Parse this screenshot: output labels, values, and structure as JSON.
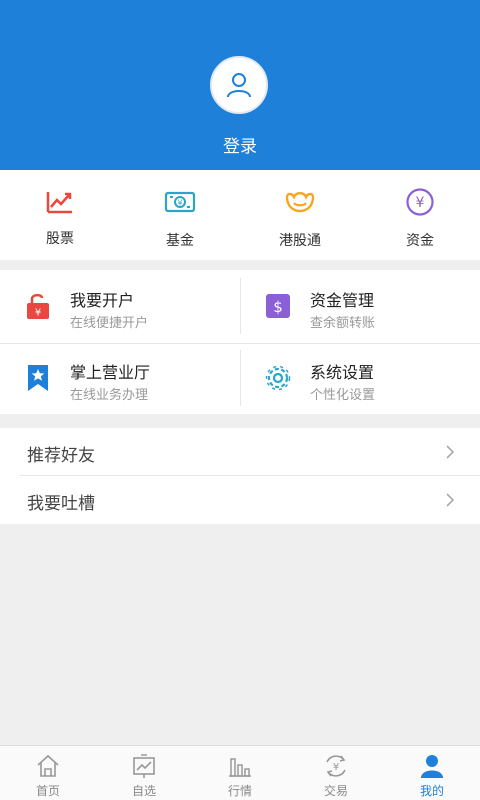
{
  "header": {
    "login_label": "登录"
  },
  "quick_links": [
    {
      "label": "股票",
      "icon": "stock-chart-icon"
    },
    {
      "label": "基金",
      "icon": "fund-cash-icon"
    },
    {
      "label": "港股通",
      "icon": "hk-connect-icon"
    },
    {
      "label": "资金",
      "icon": "yuan-circle-icon"
    }
  ],
  "services": [
    {
      "title": "我要开户",
      "subtitle": "在线便捷开户",
      "icon": "unlock-icon"
    },
    {
      "title": "资金管理",
      "subtitle": "查余额转账",
      "icon": "dollar-icon"
    },
    {
      "title": "掌上营业厅",
      "subtitle": "在线业务办理",
      "icon": "star-bookmark-icon"
    },
    {
      "title": "系统设置",
      "subtitle": "个性化设置",
      "icon": "gear-icon"
    }
  ],
  "menu": [
    {
      "label": "推荐好友"
    },
    {
      "label": "我要吐槽"
    }
  ],
  "tabbar": [
    {
      "label": "首页",
      "icon": "home-icon"
    },
    {
      "label": "自选",
      "icon": "watchlist-icon"
    },
    {
      "label": "行情",
      "icon": "market-bars-icon"
    },
    {
      "label": "交易",
      "icon": "trade-yuan-icon"
    },
    {
      "label": "我的",
      "icon": "user-icon",
      "active": true
    }
  ],
  "colors": {
    "primary": "#1f80d9",
    "red": "#e8483f",
    "orange": "#f5a623",
    "purple": "#8b5fd6",
    "teal": "#2aa5c9"
  }
}
